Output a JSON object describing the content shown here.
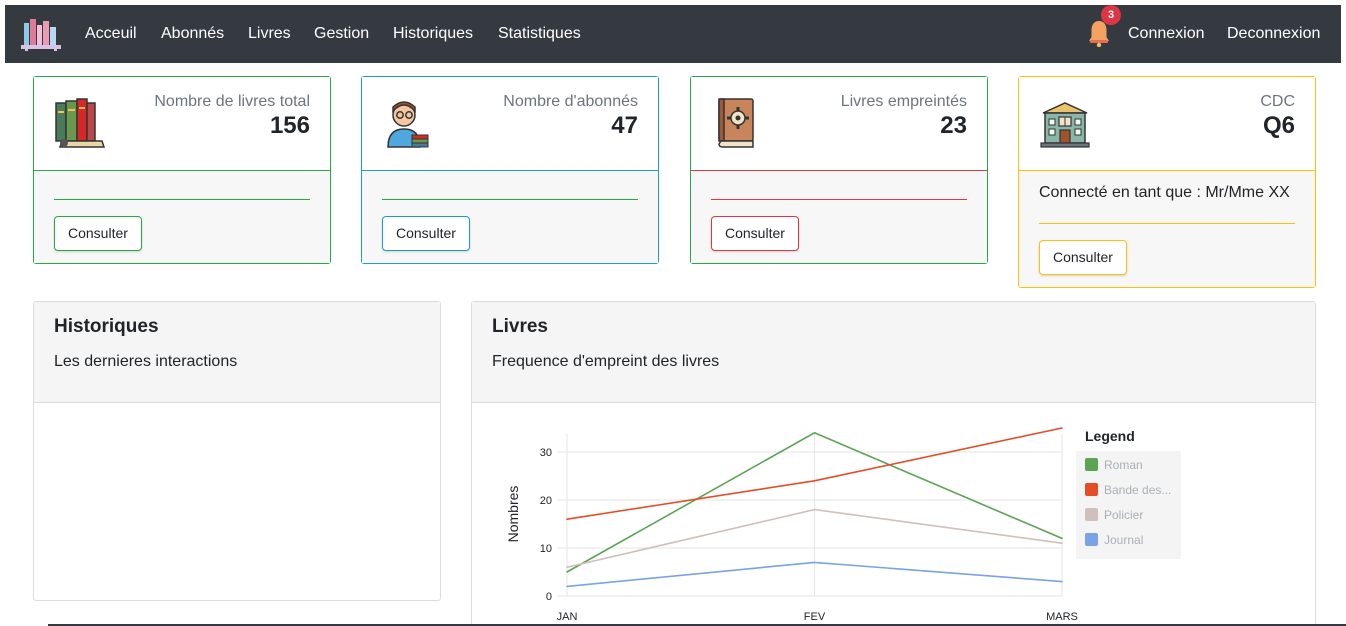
{
  "navbar": {
    "items": [
      {
        "label": "Acceuil"
      },
      {
        "label": "Abonnés"
      },
      {
        "label": "Livres"
      },
      {
        "label": "Gestion"
      },
      {
        "label": "Historiques"
      },
      {
        "label": "Statistiques"
      }
    ],
    "notification_count": "3",
    "login_label": "Connexion",
    "logout_label": "Deconnexion",
    "logo_icon": "books-shelf-icon",
    "bell_icon": "bell-icon"
  },
  "cards": {
    "books": {
      "label": "Nombre de livres total",
      "value": "156",
      "button": "Consulter",
      "icon": "books-icon",
      "color": "#28a745"
    },
    "subscribers": {
      "label": "Nombre d'abonnés",
      "value": "47",
      "button": "Consulter",
      "icon": "reader-icon",
      "color": "#17a2b8"
    },
    "borrowed": {
      "label": "Livres empreintés",
      "value": "23",
      "button": "Consulter",
      "icon": "book-gear-icon",
      "color": "#dc3545"
    },
    "cdc": {
      "label": "CDC",
      "value": "Q6",
      "connected_text": "Connecté en tant que : Mr/Mme XX",
      "button": "Consulter",
      "icon": "library-building-icon",
      "color": "#ffc107"
    }
  },
  "history_panel": {
    "title": "Historiques",
    "subtitle": "Les dernieres interactions"
  },
  "books_panel": {
    "title": "Livres",
    "subtitle": "Frequence d'empreint des livres"
  },
  "chart_data": {
    "type": "line",
    "title": "",
    "xlabel": "",
    "ylabel": "Nombres",
    "categories": [
      "JAN",
      "FEV",
      "MARS"
    ],
    "ylim": [
      0,
      35
    ],
    "yticks": [
      "0",
      "10",
      "20",
      "30"
    ],
    "grid": true,
    "legend_title": "Legend",
    "legend_position": "right",
    "series": [
      {
        "name": "Roman",
        "color": "#5aa454",
        "values": [
          5,
          34,
          12
        ]
      },
      {
        "name": "Bande des...",
        "color": "#e44d25",
        "values": [
          16,
          24,
          35
        ]
      },
      {
        "name": "Policier",
        "color": "#cfc0bb",
        "values": [
          6,
          18,
          11
        ]
      },
      {
        "name": "Journal",
        "color": "#7aa3e5",
        "values": [
          2,
          7,
          3
        ]
      }
    ]
  }
}
